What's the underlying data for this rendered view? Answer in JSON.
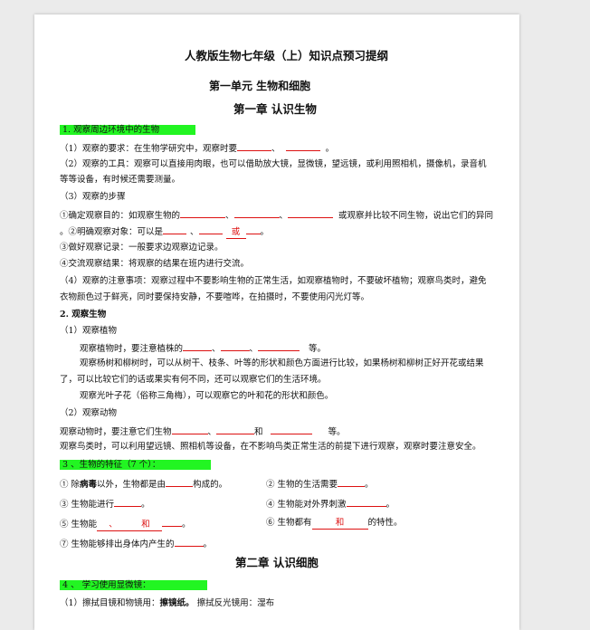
{
  "doc": {
    "title": "人教版生物七年级（上）知识点预习提纲",
    "unit_title": "第一单元   生物和细胞",
    "chapter1_title": "第一章  认识生物",
    "s1_heading": "1. 观察周边环境中的生物",
    "l1": "（1）观察的要求：在生物学研究中，观察时要",
    "l1_sep": "、",
    "l1_end": "。",
    "l2a": "（2）观察的工具：观察可以直接用肉眼，也可以借助放大镜，显微镜，望远镜，或利用照相机，摄像机，录音机",
    "l2b": "等等设备，有时候还需要测量。",
    "l3": "（3）观察的步骤",
    "l4_pre": "①确定观察目的：如观察生物的",
    "l4_sep": "、",
    "l4_post": "或观察并比较不同生物，说出它们的异同",
    "l5_pre": "。②明确观察对象：可以是",
    "l5_sep": "、",
    "l5_or": "或",
    "l5_end": "。",
    "l6": "③做好观察记录：一般要求边观察边记录。",
    "l7": "④交流观察结果：将观察的结果在班内进行交流。",
    "l8a": "（4）观察的注意事项：观察过程中不要影响生物的正常生活，如观察植物时，不要破坏植物；观察鸟类时，避免",
    "l8b": "衣物颜色过于鲜亮，同时要保持安静，不要喧哗，在拍摄时，不要使用闪光灯等。",
    "s2_heading": "2. 观察生物",
    "l9": "（1）观察植物",
    "l10_pre": "观察植物时，要注意植株的",
    "l10_sep": "、",
    "l10_end": "等。",
    "l11a": "观察杨树和柳树时，可以从树干、枝条、叶等的形状和颜色方面进行比较，如果杨树和柳树正好开花或结果",
    "l11b": "了，可以比较它们的话或果实有何不同，还可以观察它们的生活环境。",
    "l12": "观察光叶子花（俗称三角梅），可以观察它的叶和花的形状和颜色。",
    "l13": "（2）观察动物",
    "l14_pre": "观察动物时，要注意它们生物",
    "l14_sep": "、",
    "l14_and": "和",
    "l14_end": "等。",
    "l15": "观察鸟类时，可以利用望远镜、照相机等设备，在不影响鸟类正常生活的前提下进行观察，观察时要注意安全。",
    "s3_heading": "3 、生物的特征（7 个）：",
    "f1_pre": "① 除",
    "f1_bold": "病毒",
    "f1_post": "以外，生物都是由",
    "f1_end": "构成的。",
    "f2_pre": "② 生物的生活需要",
    "f2_end": "。",
    "f3_pre": "③ 生物能进行",
    "f3_end": "。",
    "f4_pre": "④ 生物能对外界刺激",
    "f4_end": "。",
    "f5_pre": "⑤ 生物能",
    "f5_sep": "、",
    "f5_and": "和",
    "f5_end": "。",
    "f6_pre": "⑥ 生物都有",
    "f6_and": "和",
    "f6_end": "的特性。",
    "f7_pre": "⑦ 生物能够排出身体内产生的",
    "f7_end": "。",
    "chapter2_title": "第二章    认识细胞",
    "s4_heading": "4 、 学习使用显微镜：",
    "l16_pre": "（1）擦拭目镜和物镜用：",
    "l16_bold": "擦镜纸。",
    "l16_post": "   擦拭反光镜用：湿布"
  }
}
